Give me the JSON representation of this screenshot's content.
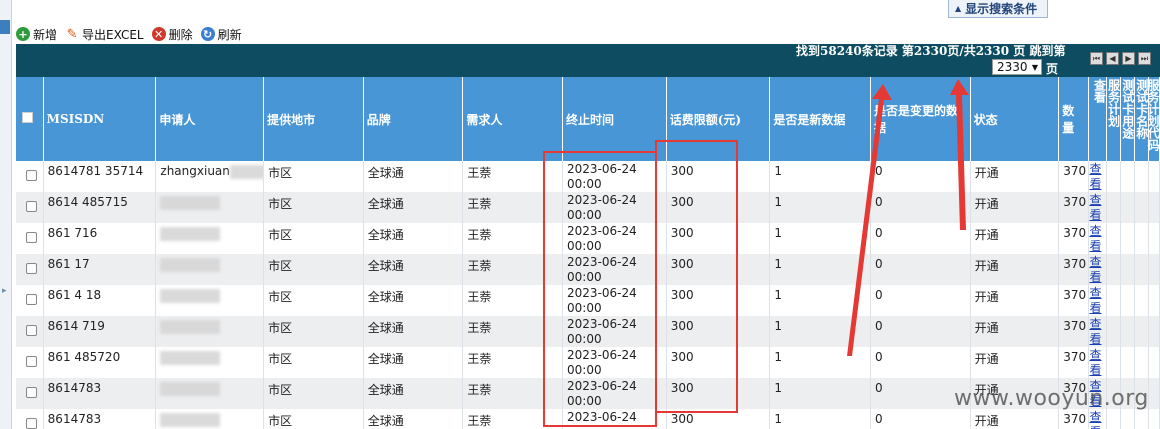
{
  "search_toggle": "显示搜索条件",
  "toolbar": {
    "add": "新增",
    "export": "导出EXCEL",
    "delete": "删除",
    "refresh": "刷新"
  },
  "pager": {
    "info": "找到58240条记录 第2330页/共2330 页 跳到第",
    "jump_value": "2330",
    "page_unit": "页"
  },
  "columns": {
    "msisdn": "MSISDN",
    "applicant": "申请人",
    "region": "提供地市",
    "brand": "品牌",
    "requester": "需求人",
    "end_time": "终止时间",
    "limit": "话费限额(元)",
    "is_new": "是否是新数据",
    "is_changed": "是否是变更的数据",
    "status": "状态",
    "quantity": "数量",
    "view": "查看",
    "service_plan": "服务计划",
    "test_card_use": "测试卡用途",
    "test_card_name": "测试卡名称",
    "plan_code": "服务计划代码"
  },
  "rows": [
    {
      "msisdn": "8614781 35714",
      "applicant": "zhangxiuan",
      "region": "市区",
      "brand": "全球通",
      "requester": "王萘",
      "end_date": "2023-06-24",
      "end_clock": "00:00",
      "limit": "300",
      "is_new": "1",
      "is_changed": "0",
      "status": "开通",
      "quantity": "370",
      "view": "查看"
    },
    {
      "msisdn": "8614 485715",
      "applicant": "",
      "region": "市区",
      "brand": "全球通",
      "requester": "王萘",
      "end_date": "2023-06-24",
      "end_clock": "00:00",
      "limit": "300",
      "is_new": "1",
      "is_changed": "0",
      "status": "开通",
      "quantity": "370",
      "view": "查看"
    },
    {
      "msisdn": "861 716",
      "applicant": "",
      "region": "市区",
      "brand": "全球通",
      "requester": "王萘",
      "end_date": "2023-06-24",
      "end_clock": "00:00",
      "limit": "300",
      "is_new": "1",
      "is_changed": "0",
      "status": "开通",
      "quantity": "370",
      "view": "查看"
    },
    {
      "msisdn": "861 17",
      "applicant": "",
      "region": "市区",
      "brand": "全球通",
      "requester": "王萘",
      "end_date": "2023-06-24",
      "end_clock": "00:00",
      "limit": "300",
      "is_new": "1",
      "is_changed": "0",
      "status": "开通",
      "quantity": "370",
      "view": "查看"
    },
    {
      "msisdn": "861 4 18",
      "applicant": "",
      "region": "市区",
      "brand": "全球通",
      "requester": "王萘",
      "end_date": "2023-06-24",
      "end_clock": "00:00",
      "limit": "300",
      "is_new": "1",
      "is_changed": "0",
      "status": "开通",
      "quantity": "370",
      "view": "查看"
    },
    {
      "msisdn": "8614 719",
      "applicant": "",
      "region": "市区",
      "brand": "全球通",
      "requester": "王萘",
      "end_date": "2023-06-24",
      "end_clock": "00:00",
      "limit": "300",
      "is_new": "1",
      "is_changed": "0",
      "status": "开通",
      "quantity": "370",
      "view": "查看"
    },
    {
      "msisdn": "861 485720",
      "applicant": "",
      "region": "市区",
      "brand": "全球通",
      "requester": "王萘",
      "end_date": "2023-06-24",
      "end_clock": "00:00",
      "limit": "300",
      "is_new": "1",
      "is_changed": "0",
      "status": "开通",
      "quantity": "370",
      "view": "查看"
    },
    {
      "msisdn": "8614783",
      "applicant": "",
      "region": "市区",
      "brand": "全球通",
      "requester": "王萘",
      "end_date": "2023-06-24",
      "end_clock": "00:00",
      "limit": "300",
      "is_new": "1",
      "is_changed": "0",
      "status": "开通",
      "quantity": "370",
      "view": "查看"
    },
    {
      "msisdn": "8614783",
      "applicant": "",
      "region": "市区",
      "brand": "全球通",
      "requester": "王萘",
      "end_date": "2023-06-24",
      "end_clock": "",
      "limit": "300",
      "is_new": "1",
      "is_changed": "0",
      "status": "开通",
      "quantity": "370",
      "view": "查看"
    }
  ],
  "watermark": "www.wooyun.org",
  "colors": {
    "pager_bg": "#0e4d61",
    "header_bg": "#4996d6",
    "row_alt": "#eceef0",
    "highlight": "#e53935",
    "link": "#1a3fb0"
  }
}
